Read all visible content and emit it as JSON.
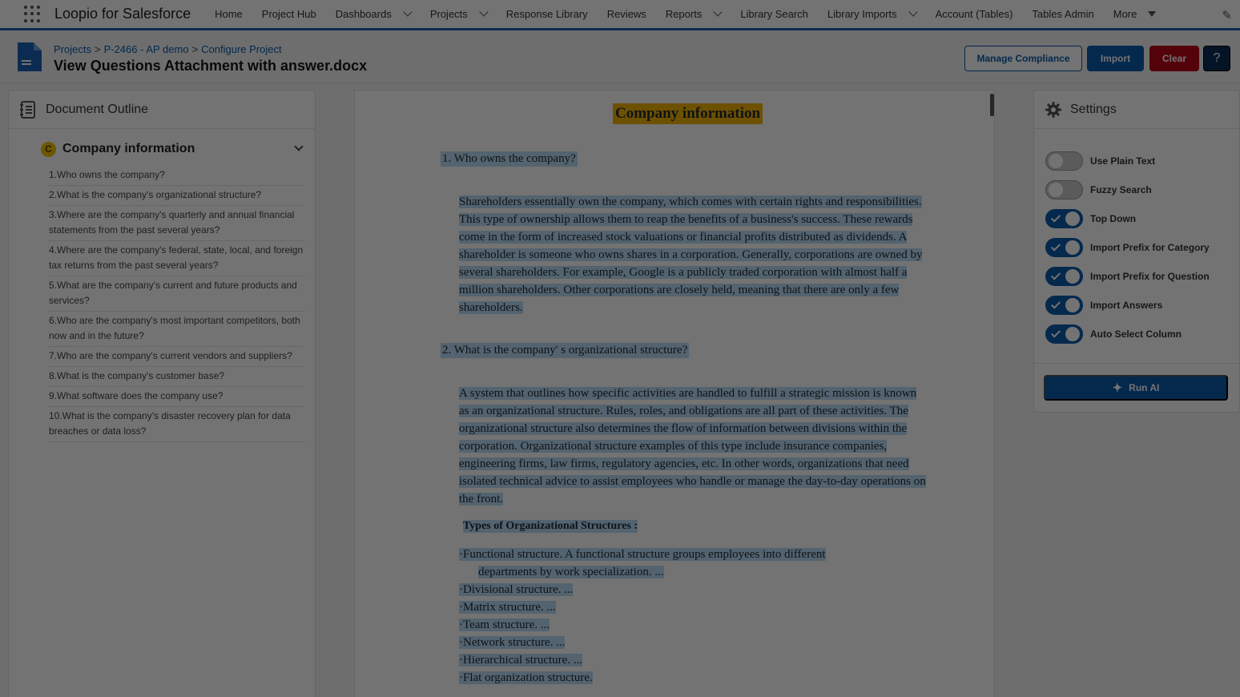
{
  "app": {
    "name": "Loopio for Salesforce"
  },
  "nav": {
    "items": [
      {
        "label": "Home",
        "dropdown": false
      },
      {
        "label": "Project Hub",
        "dropdown": false
      },
      {
        "label": "Dashboards",
        "dropdown": true
      },
      {
        "label": "Projects",
        "dropdown": true
      },
      {
        "label": "Response Library",
        "dropdown": false
      },
      {
        "label": "Reviews",
        "dropdown": false
      },
      {
        "label": "Reports",
        "dropdown": true
      },
      {
        "label": "Library Search",
        "dropdown": false
      },
      {
        "label": "Library Imports",
        "dropdown": true
      },
      {
        "label": "Account (Tables)",
        "dropdown": false
      },
      {
        "label": "Tables Admin",
        "dropdown": false
      }
    ],
    "more_label": "More"
  },
  "header": {
    "breadcrumb": [
      "Projects",
      "P-2466 - AP demo",
      "Configure Project"
    ],
    "breadcrumb_sep": ">",
    "title": "View Questions Attachment with answer.docx",
    "buttons": {
      "manage": "Manage Compliance",
      "import": "Import",
      "clear": "Clear",
      "help": "?"
    }
  },
  "outline": {
    "title": "Document Outline",
    "section": {
      "badge": "C",
      "label": "Company information"
    },
    "questions": [
      "1.Who owns the company?",
      "2.What is the company's organizational structure?",
      "3.Where are the company's quarterly and annual financial statements from the past several years?",
      "4.Where are the company's federal, state, local, and foreign tax returns from the past several years?",
      "5.What are the company's current and future products and services?",
      "6.Who are the company's most important competitors, both now and in the future?",
      "7.Who are the company's current vendors and suppliers?",
      "8.What is the company's customer base?",
      "9.What software does the company use?",
      "10.What is the company's disaster recovery plan for data breaches or data loss?"
    ]
  },
  "document": {
    "title": "Company information",
    "q1": "1. Who owns the company?",
    "a1": "Shareholders essentially own the company, which comes with certain rights and responsibilities. This type of ownership allows them to reap the benefits of a business's success. These rewards come in the form of increased stock valuations or financial profits distributed as dividends.   A shareholder is someone who owns shares in a corporation. Generally, corporations are owned by several shareholders. For example, Google is a publicly traded corporation with almost half a million shareholders. Other corporations are closely held, meaning that there are only a few shareholders.",
    "q2": "2. What is the company' s organizational structure?",
    "a2": "A system that outlines how specific activities are handled to fulfill a strategic mission  is known as an organizational structure. Rules, roles, and obligations are all part of these activities. The organizational structure also determines the flow of information between divisions within the corporation. Organizational structure examples of this type include insurance companies, engineering firms, law firms, regulatory agencies, etc. In other words, organizations that need isolated technical advice to assist employees who handle or manage the day-to-day operations on the front.",
    "subheading": "Types of Organizational Structures :",
    "bullets": [
      "·Functional structure. A functional structure groups employees into different",
      "departments by work specialization. ...",
      "·Divisional structure. ...",
      "·Matrix structure. ...",
      "·Team structure. ...",
      "·Network structure. ...",
      "·Hierarchical structure. ...",
      "·Flat organization structure."
    ]
  },
  "settings": {
    "title": "Settings",
    "toggles": [
      {
        "label": "Use Plain Text",
        "on": false
      },
      {
        "label": "Fuzzy Search",
        "on": false
      },
      {
        "label": "Top Down",
        "on": true
      },
      {
        "label": "Import Prefix for Category",
        "on": true
      },
      {
        "label": "Import Prefix for Question",
        "on": true
      },
      {
        "label": "Import Answers",
        "on": true
      },
      {
        "label": "Auto Select Column",
        "on": true
      }
    ],
    "run_ai_label": "Run AI"
  }
}
